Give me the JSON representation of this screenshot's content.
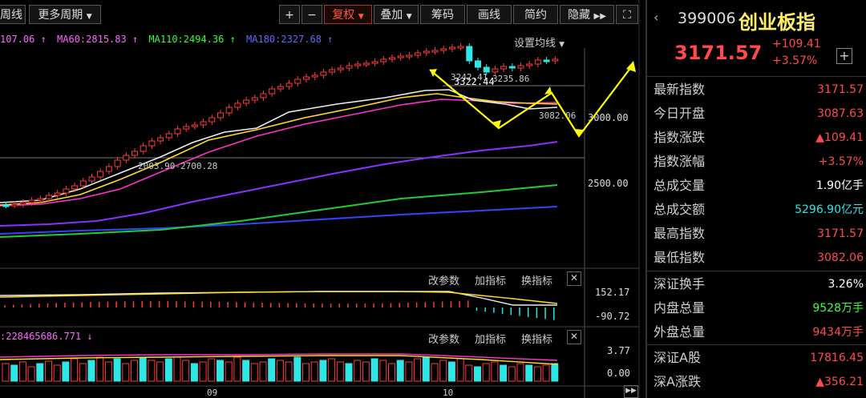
{
  "toolbar": {
    "left_tab": "周线",
    "more_period": "更多周期",
    "plus": "+",
    "minus": "−",
    "fuquan": "复权",
    "diejia": "叠加",
    "chouma": "筹码",
    "huaxian": "画线",
    "jianyue": "简约",
    "yincang": "隐藏"
  },
  "ma_line": {
    "ma_a": "107.06 ↑",
    "ma60": "MA60:2815.83 ↑",
    "ma110": "MA110:2494.36 ↑",
    "ma180": "MA180:2327.68 ↑"
  },
  "main_chart": {
    "set_ma": "设置均线",
    "high_label": "3322.44",
    "high_label2": "3242.41",
    "high_label3": "3235.86",
    "low_label": "2003.90-2700.28",
    "mid_label": "3082.06",
    "axis_3000": "3000.00",
    "axis_2500": "2500.00"
  },
  "macd_panel": {
    "btn_param": "改参数",
    "btn_add": "加指标",
    "btn_swap": "换指标",
    "axis_top": "152.17",
    "axis_bottom": "-90.72"
  },
  "vol_panel": {
    "label": ":228465686.771 ↓",
    "btn_param": "改参数",
    "btn_add": "加指标",
    "btn_swap": "换指标",
    "axis_top": "3.77",
    "axis_bottom": "0.00"
  },
  "x_axis": {
    "m09": "09",
    "m10": "10"
  },
  "quote": {
    "code": "399006",
    "name": "创业板指",
    "price": "3171.57",
    "change": "+109.41",
    "change_pct": "+3.57%",
    "rows": [
      {
        "k": "最新指数",
        "v": "3171.57",
        "c": "red"
      },
      {
        "k": "今日开盘",
        "v": "3087.63",
        "c": "red"
      },
      {
        "k": "指数涨跌",
        "v": "▲109.41",
        "c": "red"
      },
      {
        "k": "指数涨幅",
        "v": "+3.57%",
        "c": "red"
      },
      {
        "k": "总成交量",
        "v": "1.90亿手",
        "c": "white"
      },
      {
        "k": "总成交额",
        "v": "5296.90亿元",
        "c": "cyan"
      },
      {
        "k": "最高指数",
        "v": "3171.57",
        "c": "red"
      },
      {
        "k": "最低指数",
        "v": "3082.06",
        "c": "red"
      },
      {
        "k": "深证换手",
        "v": "3.26%",
        "c": "white"
      },
      {
        "k": "内盘总量",
        "v": "9528万手",
        "c": "green"
      },
      {
        "k": "外盘总量",
        "v": "9434万手",
        "c": "red"
      },
      {
        "k": "深证A股",
        "v": "17816.45",
        "c": "red"
      },
      {
        "k": "深A涨跌",
        "v": "▲356.21",
        "c": "red"
      }
    ]
  },
  "colors": {
    "up": "#ff3b3b",
    "down": "#2ee6e6",
    "accent": "#ff5a3c"
  }
}
